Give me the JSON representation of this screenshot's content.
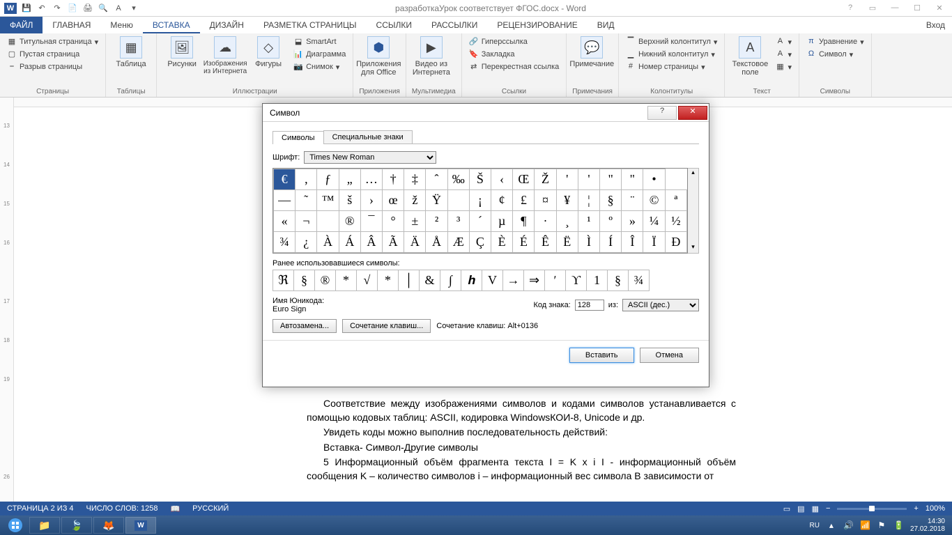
{
  "app": {
    "title": "разработкаУрок соответствует ФГОС.docx - Word"
  },
  "tabs": {
    "file": "ФАЙЛ",
    "items": [
      "ГЛАВНАЯ",
      "Меню",
      "ВСТАВКА",
      "ДИЗАЙН",
      "РАЗМЕТКА СТРАНИЦЫ",
      "ССЫЛКИ",
      "РАССЫЛКИ",
      "РЕЦЕНЗИРОВАНИЕ",
      "ВИД"
    ],
    "active_index": 2,
    "signin": "Вход"
  },
  "ribbon": {
    "groups": [
      {
        "label": "Страницы",
        "items": [
          "Титульная страница",
          "Пустая страница",
          "Разрыв страницы"
        ]
      },
      {
        "label": "Таблицы",
        "big": "Таблица"
      },
      {
        "label": "Иллюстрации",
        "bigs": [
          "Рисунки",
          "Изображения из Интернета",
          "Фигуры"
        ],
        "items": [
          "SmartArt",
          "Диаграмма",
          "Снимок"
        ]
      },
      {
        "label": "Приложения",
        "big": "Приложения для Office"
      },
      {
        "label": "Мультимедиа",
        "big": "Видео из Интернета"
      },
      {
        "label": "Ссылки",
        "items": [
          "Гиперссылка",
          "Закладка",
          "Перекрестная ссылка"
        ]
      },
      {
        "label": "Примечания",
        "big": "Примечание"
      },
      {
        "label": "Колонтитулы",
        "items": [
          "Верхний колонтитул",
          "Нижний колонтитул",
          "Номер страницы"
        ]
      },
      {
        "label": "Текст",
        "big": "Текстовое поле"
      },
      {
        "label": "Символы",
        "items": [
          "Уравнение",
          "Символ"
        ]
      }
    ]
  },
  "vruler": [
    "",
    "13",
    "",
    "14",
    "",
    "15",
    "",
    "16",
    "",
    "",
    "17",
    "",
    "18",
    "",
    "19",
    "",
    "",
    "",
    "",
    "26"
  ],
  "dialog": {
    "title": "Символ",
    "tabs": [
      "Символы",
      "Специальные знаки"
    ],
    "font_label": "Шрифт:",
    "font_value": "Times New Roman",
    "grid": [
      [
        "€",
        "‚",
        "ƒ",
        "„",
        "…",
        "†",
        "‡",
        "ˆ",
        "‰",
        "Š",
        "‹",
        "Œ",
        "Ž",
        "'",
        "'",
        "\"",
        "\"",
        "•"
      ],
      [
        "—",
        "˜",
        "™",
        "š",
        "›",
        "œ",
        "ž",
        "Ÿ",
        " ",
        "¡",
        "¢",
        "£",
        "¤",
        "¥",
        "¦",
        "§",
        "¨",
        "©",
        "ª"
      ],
      [
        "«",
        "¬",
        "­",
        "®",
        "¯",
        "°",
        "±",
        "²",
        "³",
        "´",
        "µ",
        "¶",
        "·",
        "¸",
        "¹",
        "º",
        "»",
        "¼",
        "½"
      ],
      [
        "¾",
        "¿",
        "À",
        "Á",
        "Â",
        "Ã",
        "Ä",
        "Å",
        "Æ",
        "Ç",
        "È",
        "É",
        "Ê",
        "Ë",
        "Ì",
        "Í",
        "Î",
        "Ï",
        "Ð"
      ]
    ],
    "recent_label": "Ранее использовавшиеся символы:",
    "recent": [
      "ℜ",
      "§",
      "®",
      "*",
      "√",
      "*",
      "│",
      "&",
      "∫",
      "𝒉",
      "V",
      "→",
      "⇒",
      "ʹ",
      "ϒ",
      "1",
      "§",
      "¾"
    ],
    "unicode_label": "Имя Юникода:",
    "unicode_name": "Euro Sign",
    "code_label": "Код знака:",
    "code_value": "128",
    "from_label": "из:",
    "from_value": "ASCII (дес.)",
    "autocorrect": "Автозамена...",
    "shortcut_btn": "Сочетание клавиш...",
    "shortcut_text": "Сочетание клавиш: Alt+0136",
    "insert": "Вставить",
    "cancel": "Отмена"
  },
  "document": {
    "p1": "Соответствие между изображениями символов и кодами символов устанавливается с помощью кодовых таблиц: ASCII, кодировка WindowsКОИ-8, Unicode и др.",
    "p2": "Увидеть коды можно выполнив последовательность действий:",
    "p3": "Вставка- Символ-Другие символы",
    "p4": "5 Информационный объём фрагмента текста I = K x i I - информационный объём сообщения K – количество символов i – информационный вес символа В зависимости от"
  },
  "status": {
    "page": "СТРАНИЦА 2 ИЗ 4",
    "words": "ЧИСЛО СЛОВ: 1258",
    "lang": "РУССКИЙ",
    "zoom": "100%"
  },
  "taskbar": {
    "lang": "RU",
    "time": "14:30",
    "date": "27.02.2018"
  }
}
